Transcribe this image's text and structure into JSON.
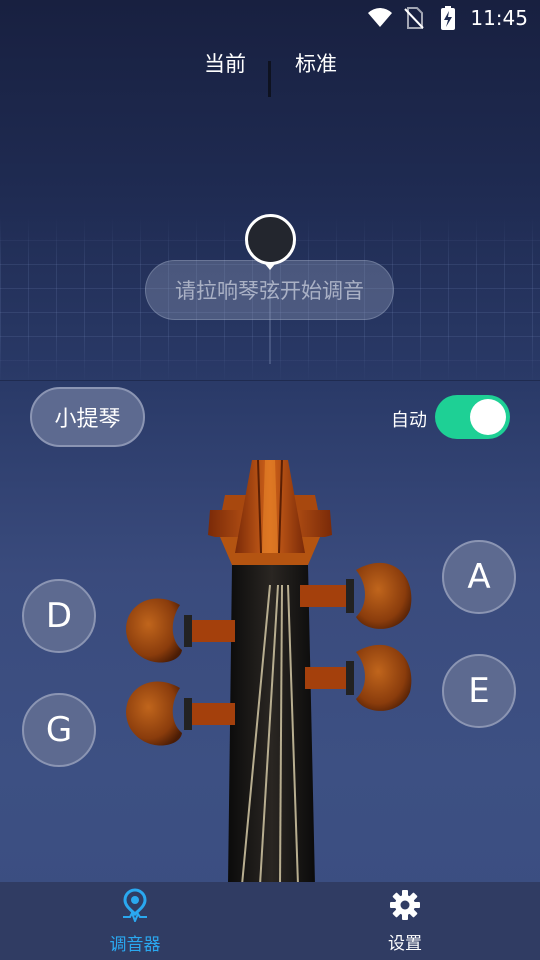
{
  "status_bar": {
    "time": "11:45",
    "icons": [
      "wifi-icon",
      "no-sim-icon",
      "battery-charging-icon"
    ]
  },
  "tuner": {
    "current_label": "当前",
    "standard_label": "标准",
    "hint": "请拉响琴弦开始调音"
  },
  "controls": {
    "instrument": "小提琴",
    "auto_label": "自动",
    "auto_enabled": true
  },
  "strings": [
    {
      "name": "D",
      "side": "left"
    },
    {
      "name": "G",
      "side": "left"
    },
    {
      "name": "A",
      "side": "right"
    },
    {
      "name": "E",
      "side": "right"
    }
  ],
  "nav": {
    "items": [
      {
        "label": "调音器",
        "icon": "tuner-pin-icon",
        "active": true
      },
      {
        "label": "设置",
        "icon": "gear-icon",
        "active": false
      }
    ]
  },
  "colors": {
    "accent": "#2aa8f0",
    "toggle_on": "#1ed095",
    "button_bg": "#5d6a90"
  }
}
